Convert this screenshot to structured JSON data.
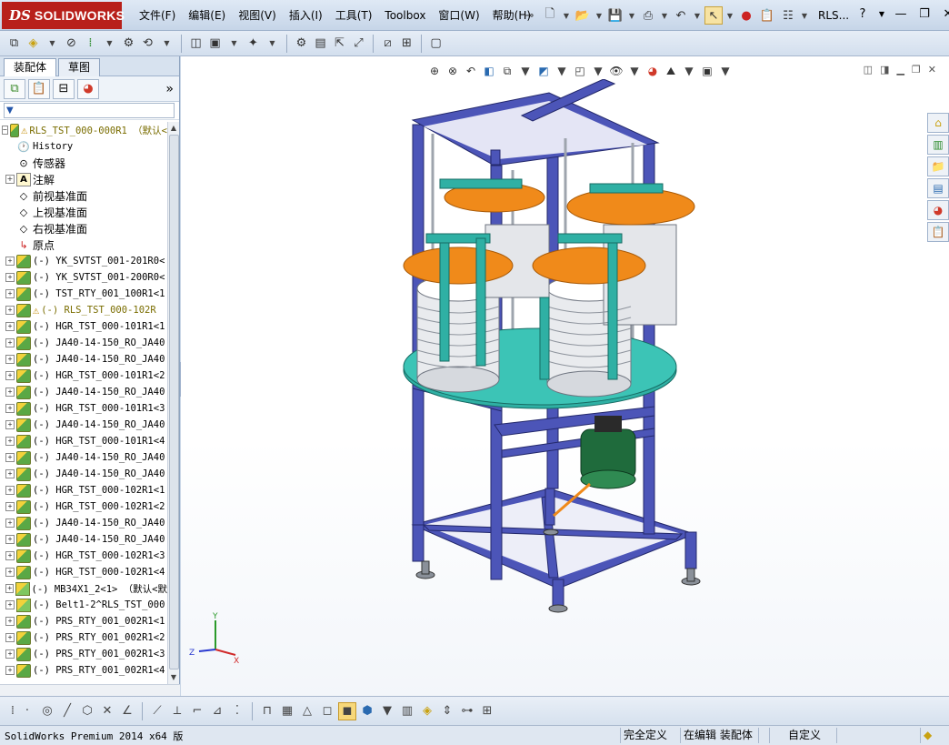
{
  "app": {
    "logo_ds": "DS",
    "logo_name": "SOLIDWORKS",
    "window_title": "RLS...",
    "menu": [
      "文件(F)",
      "编辑(E)",
      "视图(V)",
      "插入(I)",
      "工具(T)",
      "Toolbox",
      "窗口(W)",
      "帮助(H)"
    ]
  },
  "tabs": [
    "装配体",
    "草图"
  ],
  "filter_symbol": "▼",
  "tree": {
    "root": "RLS_TST_000-000R1 （默认<",
    "items": [
      {
        "label": "History",
        "icon": "history-icon",
        "expand": false,
        "mono": true
      },
      {
        "label": "传感器",
        "icon": "sensor-icon",
        "expand": false,
        "mono": false
      },
      {
        "label": "注解",
        "icon": "annotation-icon",
        "expand": true,
        "mono": false
      },
      {
        "label": "前视基准面",
        "icon": "plane-icon",
        "expand": false,
        "mono": false
      },
      {
        "label": "上视基准面",
        "icon": "plane-icon",
        "expand": false,
        "mono": false
      },
      {
        "label": "右视基准面",
        "icon": "plane-icon",
        "expand": false,
        "mono": false
      },
      {
        "label": "原点",
        "icon": "origin-icon",
        "expand": false,
        "mono": false
      },
      {
        "label": "(-) YK_SVTST_001-201R0<",
        "icon": "assembly-icon",
        "expand": true,
        "mono": true
      },
      {
        "label": "(-) YK_SVTST_001-200R0<",
        "icon": "assembly-icon",
        "expand": true,
        "mono": true
      },
      {
        "label": "(-) TST_RTY_001_100R1<1",
        "icon": "assembly-icon",
        "expand": true,
        "mono": true
      },
      {
        "label": "(-) RLS_TST_000-102R",
        "icon": "assembly-icon",
        "expand": true,
        "mono": true,
        "warn": true
      },
      {
        "label": "(-) HGR_TST_000-101R1<1",
        "icon": "assembly-icon",
        "expand": true,
        "mono": true
      },
      {
        "label": "(-) JA40-14-150_RO_JA40",
        "icon": "assembly-icon",
        "expand": true,
        "mono": true
      },
      {
        "label": "(-) JA40-14-150_RO_JA40",
        "icon": "assembly-icon",
        "expand": true,
        "mono": true
      },
      {
        "label": "(-) HGR_TST_000-101R1<2",
        "icon": "assembly-icon",
        "expand": true,
        "mono": true
      },
      {
        "label": "(-) JA40-14-150_RO_JA40",
        "icon": "assembly-icon",
        "expand": true,
        "mono": true
      },
      {
        "label": "(-) HGR_TST_000-101R1<3",
        "icon": "assembly-icon",
        "expand": true,
        "mono": true
      },
      {
        "label": "(-) JA40-14-150_RO_JA40",
        "icon": "assembly-icon",
        "expand": true,
        "mono": true
      },
      {
        "label": "(-) HGR_TST_000-101R1<4",
        "icon": "assembly-icon",
        "expand": true,
        "mono": true
      },
      {
        "label": "(-) JA40-14-150_RO_JA40",
        "icon": "assembly-icon",
        "expand": true,
        "mono": true
      },
      {
        "label": "(-) JA40-14-150_RO_JA40",
        "icon": "assembly-icon",
        "expand": true,
        "mono": true
      },
      {
        "label": "(-) HGR_TST_000-102R1<1",
        "icon": "assembly-icon",
        "expand": true,
        "mono": true
      },
      {
        "label": "(-) HGR_TST_000-102R1<2",
        "icon": "assembly-icon",
        "expand": true,
        "mono": true
      },
      {
        "label": "(-) JA40-14-150_RO_JA40",
        "icon": "assembly-icon",
        "expand": true,
        "mono": true
      },
      {
        "label": "(-) JA40-14-150_RO_JA40",
        "icon": "assembly-icon",
        "expand": true,
        "mono": true
      },
      {
        "label": "(-) HGR_TST_000-102R1<3",
        "icon": "assembly-icon",
        "expand": true,
        "mono": true
      },
      {
        "label": "(-) HGR_TST_000-102R1<4",
        "icon": "assembly-icon",
        "expand": true,
        "mono": true
      },
      {
        "label": "(-) MB34X1_2<1> （默认<默",
        "icon": "part-icon",
        "expand": true,
        "mono": true
      },
      {
        "label": "(-) Belt1-2^RLS_TST_000",
        "icon": "part-icon",
        "expand": true,
        "mono": true
      },
      {
        "label": "(-) PRS_RTY_001_002R1<1",
        "icon": "assembly-icon",
        "expand": true,
        "mono": true
      },
      {
        "label": "(-) PRS_RTY_001_002R1<2",
        "icon": "assembly-icon",
        "expand": true,
        "mono": true
      },
      {
        "label": "(-) PRS_RTY_001_002R1<3",
        "icon": "assembly-icon",
        "expand": true,
        "mono": true
      },
      {
        "label": "(-) PRS_RTY_001_002R1<4",
        "icon": "assembly-icon",
        "expand": true,
        "mono": true
      }
    ]
  },
  "triad": {
    "x": "X",
    "y": "Y",
    "z": "Z"
  },
  "status": {
    "product": "SolidWorks Premium 2014 x64 版",
    "defined": "完全定义",
    "editing": "在编辑 装配体",
    "custom": "自定义"
  },
  "colors": {
    "frame": "#4c55b8",
    "teal": "#2fb0a4",
    "orange": "#f08a1a",
    "drum": "#e9ebee",
    "motor": "#1f6b3c"
  }
}
